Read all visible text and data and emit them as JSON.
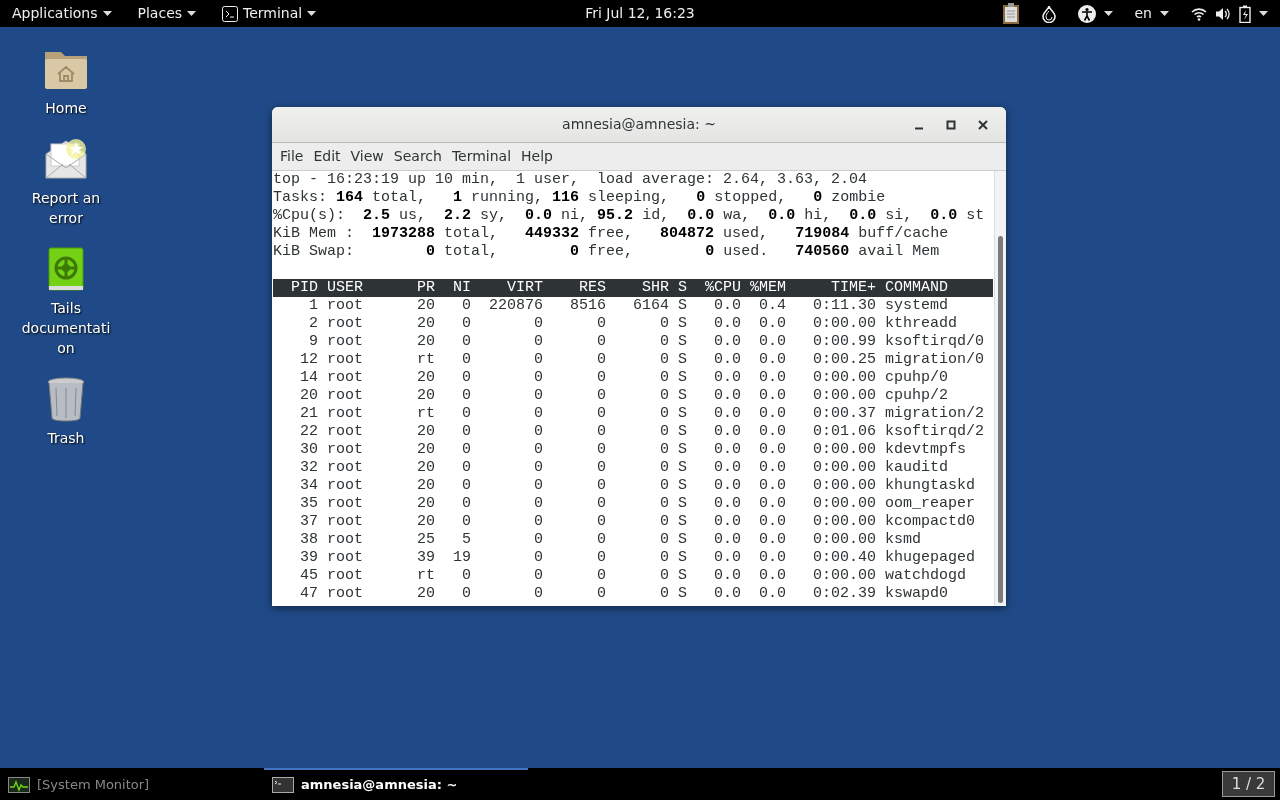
{
  "top_bar": {
    "menus": [
      {
        "label": "Applications",
        "kind": "menu"
      },
      {
        "label": "Places",
        "kind": "menu"
      },
      {
        "label": "Terminal",
        "kind": "app-menu"
      }
    ],
    "clock": "Fri Jul 12, 16:23",
    "keyboard_layout": "en"
  },
  "desktop_icons": [
    {
      "label": "Home",
      "kind": "folder"
    },
    {
      "label": "Report an error",
      "kind": "mail"
    },
    {
      "label": "Tails documentation",
      "kind": "book"
    },
    {
      "label": "Trash",
      "kind": "trash"
    }
  ],
  "window": {
    "title": "amnesia@amnesia: ~",
    "menu": [
      "File",
      "Edit",
      "View",
      "Search",
      "Terminal",
      "Help"
    ],
    "terminal": {
      "summary_lines": [
        "top - 16:23:19 up 10 min,  1 user,  load average: 2.64, 3.63, 2.04",
        "Tasks: **164** total,   **1** running, **116** sleeping,   **0** stopped,   **0** zombie",
        "%Cpu(s):  **2.5** us,  **2.2** sy,  **0.0** ni, **95.2** id,  **0.0** wa,  **0.0** hi,  **0.0** si,  **0.0** st",
        "KiB Mem :  **1973288** total,   **449332** free,   **804872** used,   **719084** buff/cache",
        "KiB Swap:        **0** total,        **0** free,        **0** used.   **740560** avail Mem"
      ],
      "table": {
        "columns": [
          "PID",
          "USER",
          "PR",
          "NI",
          "VIRT",
          "RES",
          "SHR",
          "S",
          "%CPU",
          "%MEM",
          "TIME+",
          "COMMAND"
        ],
        "rows": [
          [
            "1",
            "root",
            "20",
            "0",
            "220876",
            "8516",
            "6164",
            "S",
            "0.0",
            "0.4",
            "0:11.30",
            "systemd"
          ],
          [
            "2",
            "root",
            "20",
            "0",
            "0",
            "0",
            "0",
            "S",
            "0.0",
            "0.0",
            "0:00.00",
            "kthreadd"
          ],
          [
            "9",
            "root",
            "20",
            "0",
            "0",
            "0",
            "0",
            "S",
            "0.0",
            "0.0",
            "0:00.99",
            "ksoftirqd/0"
          ],
          [
            "12",
            "root",
            "rt",
            "0",
            "0",
            "0",
            "0",
            "S",
            "0.0",
            "0.0",
            "0:00.25",
            "migration/0"
          ],
          [
            "14",
            "root",
            "20",
            "0",
            "0",
            "0",
            "0",
            "S",
            "0.0",
            "0.0",
            "0:00.00",
            "cpuhp/0"
          ],
          [
            "20",
            "root",
            "20",
            "0",
            "0",
            "0",
            "0",
            "S",
            "0.0",
            "0.0",
            "0:00.00",
            "cpuhp/2"
          ],
          [
            "21",
            "root",
            "rt",
            "0",
            "0",
            "0",
            "0",
            "S",
            "0.0",
            "0.0",
            "0:00.37",
            "migration/2"
          ],
          [
            "22",
            "root",
            "20",
            "0",
            "0",
            "0",
            "0",
            "S",
            "0.0",
            "0.0",
            "0:01.06",
            "ksoftirqd/2"
          ],
          [
            "30",
            "root",
            "20",
            "0",
            "0",
            "0",
            "0",
            "S",
            "0.0",
            "0.0",
            "0:00.00",
            "kdevtmpfs"
          ],
          [
            "32",
            "root",
            "20",
            "0",
            "0",
            "0",
            "0",
            "S",
            "0.0",
            "0.0",
            "0:00.00",
            "kauditd"
          ],
          [
            "34",
            "root",
            "20",
            "0",
            "0",
            "0",
            "0",
            "S",
            "0.0",
            "0.0",
            "0:00.00",
            "khungtaskd"
          ],
          [
            "35",
            "root",
            "20",
            "0",
            "0",
            "0",
            "0",
            "S",
            "0.0",
            "0.0",
            "0:00.00",
            "oom_reaper"
          ],
          [
            "37",
            "root",
            "20",
            "0",
            "0",
            "0",
            "0",
            "S",
            "0.0",
            "0.0",
            "0:00.00",
            "kcompactd0"
          ],
          [
            "38",
            "root",
            "25",
            "5",
            "0",
            "0",
            "0",
            "S",
            "0.0",
            "0.0",
            "0:00.00",
            "ksmd"
          ],
          [
            "39",
            "root",
            "39",
            "19",
            "0",
            "0",
            "0",
            "S",
            "0.0",
            "0.0",
            "0:00.40",
            "khugepaged"
          ],
          [
            "45",
            "root",
            "rt",
            "0",
            "0",
            "0",
            "0",
            "S",
            "0.0",
            "0.0",
            "0:00.00",
            "watchdogd"
          ],
          [
            "47",
            "root",
            "20",
            "0",
            "0",
            "0",
            "0",
            "S",
            "0.0",
            "0.0",
            "0:02.39",
            "kswapd0"
          ]
        ]
      }
    }
  },
  "taskbar": {
    "tasks": [
      {
        "label": "[System Monitor]",
        "kind": "monitor",
        "selected": false
      },
      {
        "label": "amnesia@amnesia: ~",
        "kind": "terminal",
        "selected": true
      }
    ],
    "workspace": "1 / 2"
  }
}
